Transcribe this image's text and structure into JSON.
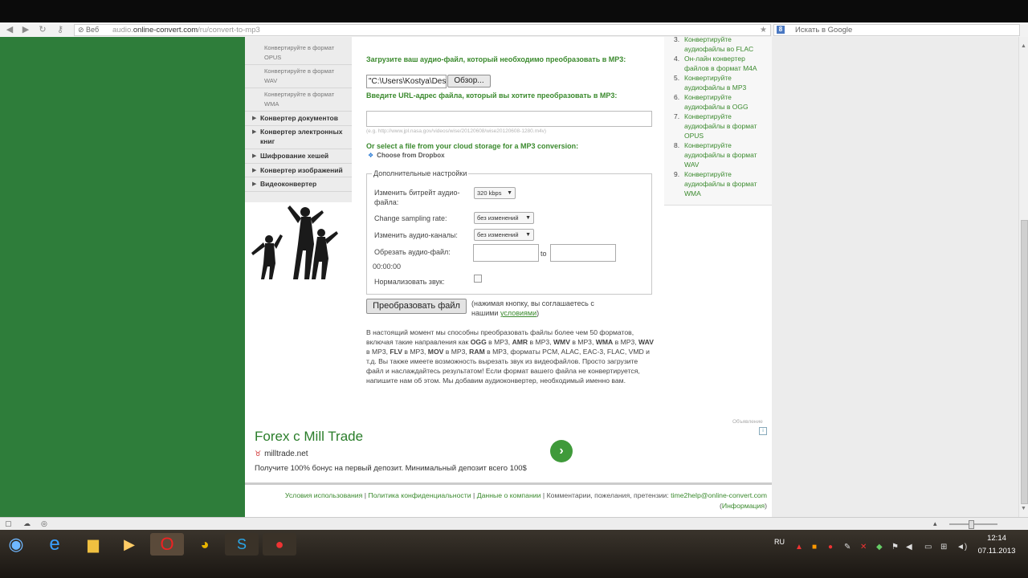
{
  "browser": {
    "web_badge": "Веб",
    "url_prefix": "audio.",
    "url_domain": "online-convert.com",
    "url_path": "/ru/convert-to-mp3",
    "search_placeholder": "Искать в Google"
  },
  "left_nav": {
    "format_items": [
      {
        "label": "Конвертируйте в формат OPUS"
      },
      {
        "label": "Конвертируйте в формат WAV"
      },
      {
        "label": "Конвертируйте в формат WMA"
      }
    ],
    "categories": [
      {
        "label": "Конвертер документов"
      },
      {
        "label": "Конвертер электронных книг"
      },
      {
        "label": "Шифрование хешей"
      },
      {
        "label": "Конвертер изображений"
      },
      {
        "label": "Видеоконвертер"
      }
    ]
  },
  "upload": {
    "heading": "Загрузите ваш аудио-файл, который необходимо преобразовать в MP3:",
    "file_value": "\"C:\\Users\\Kostya\\Desktop\\",
    "browse_label": "Обзор...",
    "url_heading": "Введите URL-адрес файла, который вы хотите преобразовать в MP3:",
    "url_hint": "(e.g. http://www.jpl.nasa.gov/videos/wise/20120608/wise20120608-1280.m4v)",
    "cloud_heading": "Or select a file from your cloud storage for a MP3 conversion:",
    "dropbox_label": "Choose from Dropbox"
  },
  "settings": {
    "legend": "Дополнительные настройки",
    "bitrate_label": "Изменить битрейт аудио-файла:",
    "bitrate_value": "320 kbps",
    "sampling_label": "Change sampling rate:",
    "sampling_value": "без изменений",
    "channels_label": "Изменить аудио-каналы:",
    "channels_value": "без изменений",
    "trim_label": "Обрезать аудио-файл:",
    "trim_to": "to",
    "trim_time": "00:00:00",
    "normalize_label": "Нормализовать звук:"
  },
  "convert": {
    "button_label": "Преобразовать файл",
    "note_prefix": "(нажимая кнопку, вы соглашаетесь с нашими ",
    "note_link": "условиями",
    "note_suffix": ")"
  },
  "description": {
    "text_1": "В настоящий момент мы способны преобразовать файлы более чем 50 форматов, включая такие направления как ",
    "b1": "OGG",
    "t2": " в MP3, ",
    "b2": "AMR",
    "t3": " в MP3, ",
    "b3": "WMV",
    "t4": " в MP3, ",
    "b4": "WMA",
    "t5": " в MP3, ",
    "b5": "WAV",
    "t6": " в MP3, ",
    "b6": "FLV",
    "t7": " в MP3, ",
    "b7": "MOV",
    "t8": " в MP3, ",
    "b8": "RAM",
    "t9": " в MP3, форматы PCM, ALAC, EAC-3, FLAC, VMD и т.д. Вы также имеете возможность вырезать звук из видеофайлов. Просто загрузите файл и наслаждайтесь результатом! Если формат вашего файла не конвертируется, напишите нам об этом. Мы добавим аудиоконвертер, необходимый именно вам."
  },
  "right_list": {
    "items": [
      {
        "num": "3.",
        "label": "Конвертируйте аудиофайлы во FLAC"
      },
      {
        "num": "4.",
        "label": "Он-лайн конвертер файлов в формат M4A"
      },
      {
        "num": "5.",
        "label": "Конвертируйте аудиофайлы в MP3"
      },
      {
        "num": "6.",
        "label": "Конвертируйте аудиофайлы в OGG"
      },
      {
        "num": "7.",
        "label": "Конвертируйте аудиофайлы в формат OPUS"
      },
      {
        "num": "8.",
        "label": "Конвертируйте аудиофайлы в формат WAV"
      },
      {
        "num": "9.",
        "label": "Конвертируйте аудиофайлы в формат WMA"
      }
    ]
  },
  "ad": {
    "label": "Объявление",
    "title": "Forex с Mill Trade",
    "domain": "milltrade.net",
    "text": "Получите 100% бонус на первый депозит. Минимальный депозит всего 100$"
  },
  "footer": {
    "link_terms": "Условия использования",
    "link_privacy": "Политика конфиденциальности",
    "link_company": "Данные о компании",
    "comments": "Комментарии, пожелания, претензии: ",
    "email": "time2help@online-convert.com",
    "info_link": "Информация"
  },
  "taskbar": {
    "lang": "RU",
    "time": "12:14",
    "date": "07.11.2013"
  }
}
